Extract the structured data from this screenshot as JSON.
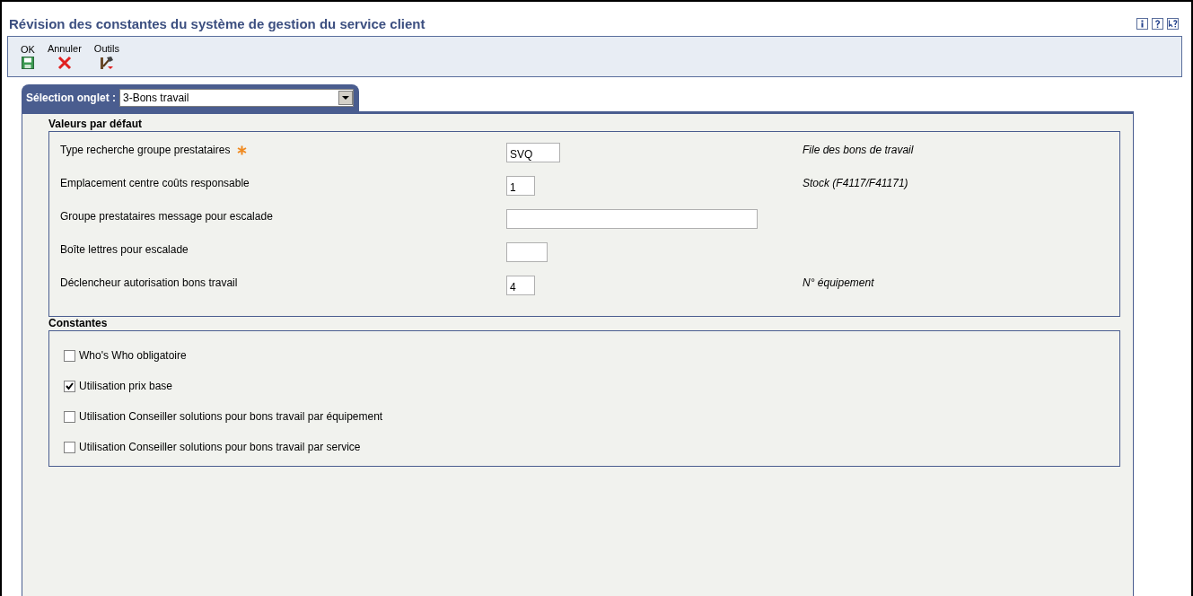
{
  "window": {
    "title": "Révision des constantes du système de gestion du service client"
  },
  "toolbar": [
    {
      "label": "OK",
      "kind": "save"
    },
    {
      "label": "Annuler",
      "kind": "cancel"
    },
    {
      "label": "Outils",
      "kind": "tools"
    }
  ],
  "tab_selector": {
    "label": "Sélection onglet :",
    "value": "3-Bons travail"
  },
  "defaults": {
    "title": "Valeurs par défaut",
    "fields": [
      {
        "label": "Type recherche groupe prestataires",
        "required": true,
        "value": "SVQ",
        "description": "File des bons de travail"
      },
      {
        "label": "Emplacement centre coûts responsable",
        "required": false,
        "value": "1",
        "description": "Stock (F4117/F41171)"
      },
      {
        "label": "Groupe prestataires message pour escalade",
        "required": false
      },
      {
        "label": "Boîte lettres pour escalade",
        "required": false
      },
      {
        "label": "Déclencheur autorisation bons travail",
        "required": false,
        "value": "4",
        "description": "N° équipement"
      }
    ]
  },
  "constants": {
    "title": "Constantes",
    "options": [
      {
        "label": "Who's Who obligatoire",
        "checked": false
      },
      {
        "label": "Utilisation prix base",
        "checked": true
      },
      {
        "label": "Utilisation Conseiller solutions pour bons travail par équipement",
        "checked": false
      },
      {
        "label": "Utilisation Conseiller solutions pour bons travail par service",
        "checked": false
      }
    ]
  }
}
